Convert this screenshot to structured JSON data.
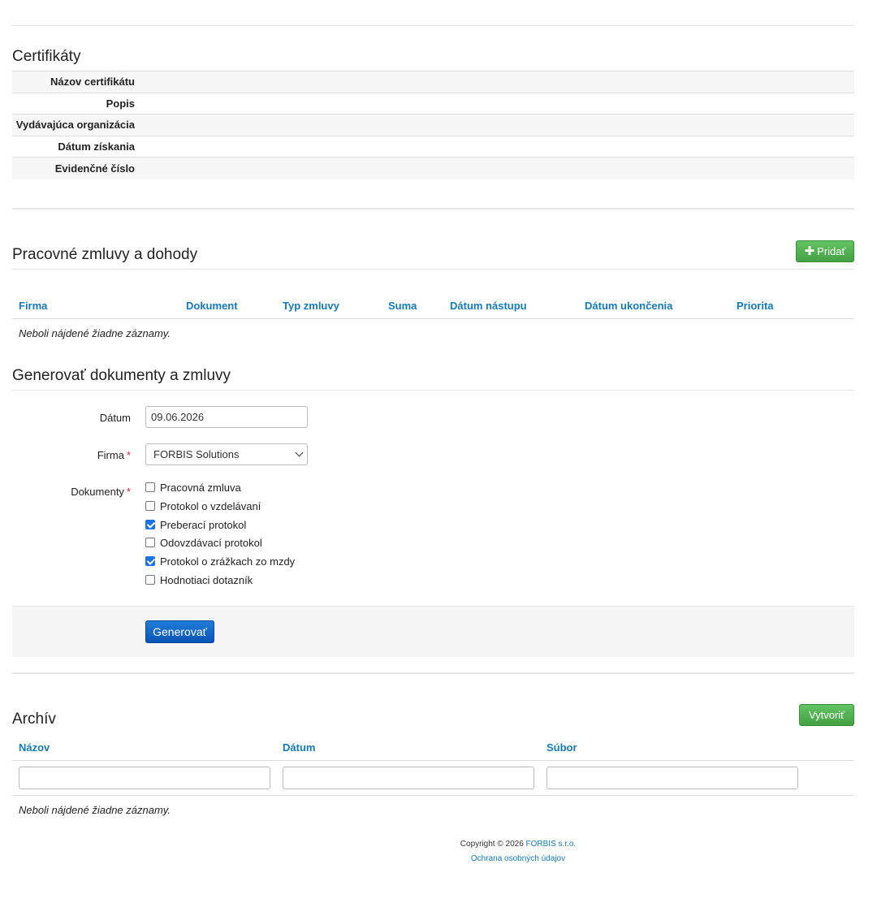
{
  "certificates": {
    "title": "Certifikáty",
    "fields": [
      "Názov certifikátu",
      "Popis",
      "Vydávajúca organizácia",
      "Dátum získania",
      "Evidenčné číslo"
    ]
  },
  "contracts": {
    "title": "Pracovné zmluvy a dohody",
    "add_button": "Pridať",
    "add_icon": "plus-icon",
    "columns": [
      "Firma",
      "Dokument",
      "Typ zmluvy",
      "Suma",
      "Dátum nástupu",
      "Dátum ukončenia",
      "Priorita"
    ],
    "empty_text": "Neboli nájdené žiadne záznamy."
  },
  "generate": {
    "title": "Generovať dokumenty a zmluvy",
    "date_label": "Dátum",
    "date_value": "09.06.2026",
    "company_label": "Firma",
    "company_value": "FORBIS Solutions",
    "documents_label": "Dokumenty",
    "required_mark": "*",
    "documents": [
      {
        "label": "Pracovná zmluva",
        "checked": false
      },
      {
        "label": "Protokol o vzdelávaní",
        "checked": false
      },
      {
        "label": "Preberací protokol",
        "checked": true
      },
      {
        "label": "Odovzdávací protokol",
        "checked": false
      },
      {
        "label": "Protokol o zrážkach zo mzdy",
        "checked": true
      },
      {
        "label": "Hodnotiaci dotazník",
        "checked": false
      }
    ],
    "submit_button": "Generovať"
  },
  "archive": {
    "title": "Archív",
    "create_button": "Vytvoriť",
    "columns": [
      "Názov",
      "Dátum",
      "Súbor"
    ],
    "empty_text": "Neboli nájdené žiadne záznamy."
  },
  "footer": {
    "copyright": "Copyright © 2026",
    "company_link": "FORBIS s.r.o.",
    "privacy_link": "Ochrana osobných údajov"
  },
  "colors": {
    "link": "#1479bd",
    "success": "#4cae4c",
    "primary": "#0a55b8",
    "required": "#d9232d"
  }
}
